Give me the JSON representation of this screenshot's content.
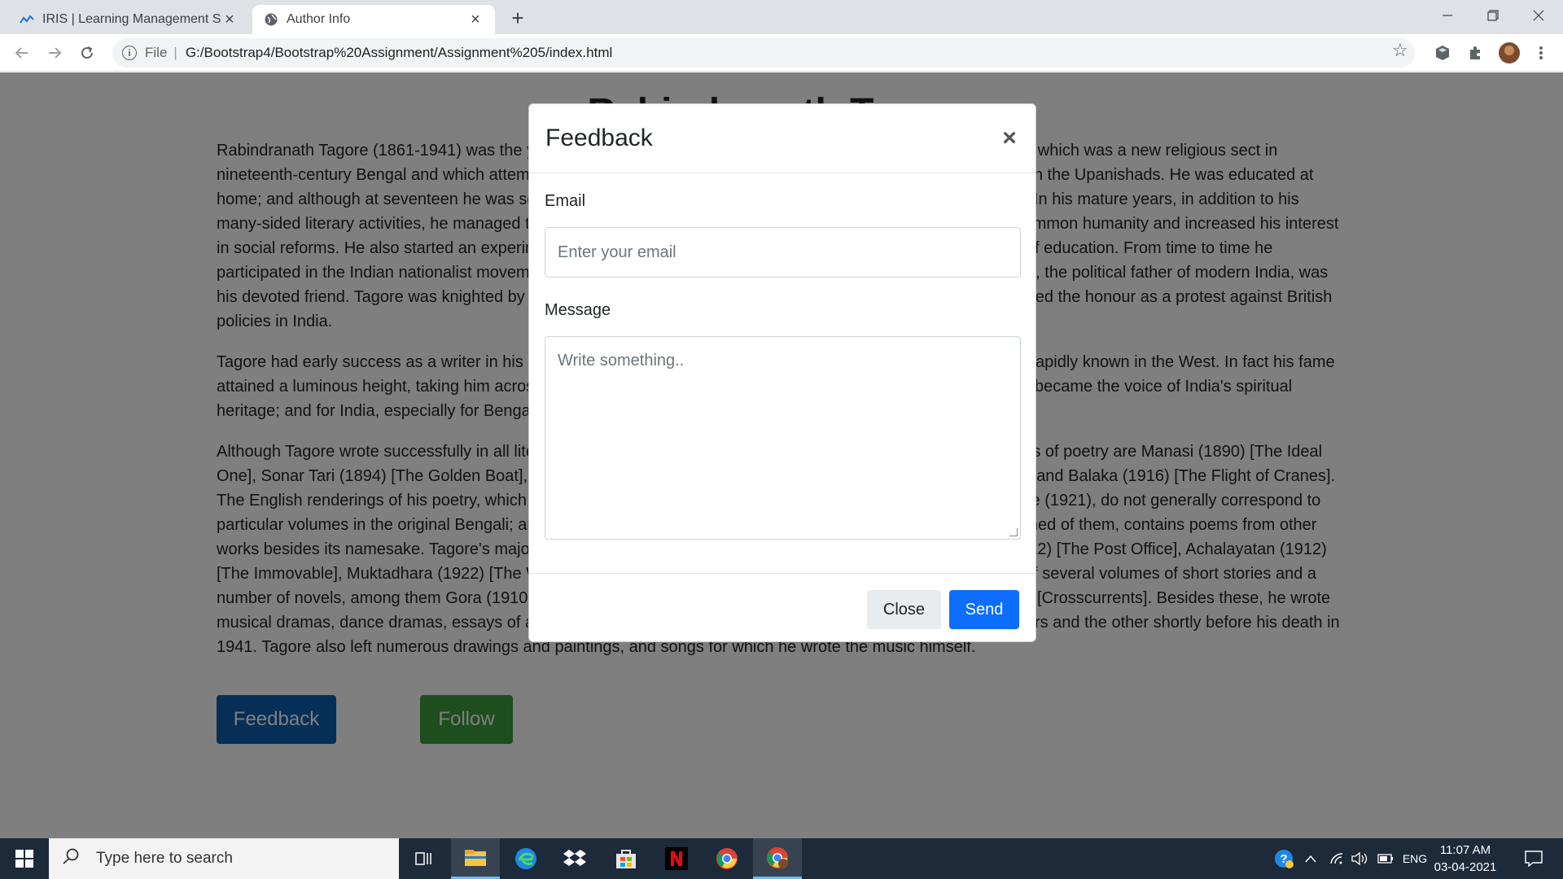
{
  "browser": {
    "tabs": [
      {
        "title": "IRIS | Learning Management Syst",
        "active": false
      },
      {
        "title": "Author Info",
        "active": true
      }
    ],
    "address": {
      "scheme": "File",
      "url": "G:/Bootstrap4/Bootstrap%20Assignment/Assignment%205/index.html"
    }
  },
  "article": {
    "title": "Rabindranath Tagore",
    "paragraphs": [
      "Rabindranath Tagore (1861-1941) was the youngest son of Debendranath Tagore, a leader of the Brahmo Samaj, which was a new religious sect in nineteenth-century Bengal and which attempted a revival of the ultimate monistic basis of Hinduism as laid down in the Upanishads. He was educated at home; and although at seventeen he was sent to England for formal schooling, he did not finish his studies there. In his mature years, in addition to his many-sided literary activities, he managed the family estates, a project which brought him into close touch with common humanity and increased his interest in social reforms. He also started an experimental school at Shantiniketan where he tried his Upanishadic ideals of education. From time to time he participated in the Indian nationalist movement, though in his own non-sentimental and visionary way; and Gandhi, the political father of modern India, was his devoted friend. Tagore was knighted by the ruling British Government in 1915, but within a few years he resigned the honour as a protest against British policies in India.",
      "Tagore had early success as a writer in his native Bengal. With his translations of some of his poems he became rapidly known in the West. In fact his fame attained a luminous height, taking him across continents on lecture tours and tours of friendship. For the world he became the voice of India's spiritual heritage; and for India, especially for Bengal, he became a great living institution.",
      "Although Tagore wrote successfully in all literary genres, he was first of all a poet. Among his fifty and odd volumes of poetry are Manasi (1890) [The Ideal One], Sonar Tari (1894) [The Golden Boat], Gitanjali (1910) [Song Offerings], Gitimalya (1914) [Wreath of Songs], and Balaka (1916) [The Flight of Cranes]. The English renderings of his poetry, which include The Gardener (1913), Fruit-Gathering (1916), and The Fugitive (1921), do not generally correspond to particular volumes in the original Bengali; and in spite of its title, Gitanjali: Song Offerings (1912), the most acclaimed of them, contains poems from other works besides its namesake. Tagore's major plays are Raja (1910) [The King of the Dark Chamber], Dakghar (1912) [The Post Office], Achalayatan (1912) [The Immovable], Muktadhara (1922) [The Waterfall], and Raktakaravi (1926) [Red Oleanders]. He is the author of several volumes of short stories and a number of novels, among them Gora (1910), Ghare-Baire (1916) [The Home and the World], and Yogayog (1929) [Crosscurrents]. Besides these, he wrote musical dramas, dance dramas, essays of all types, travel diaries, and two autobiographies, one in his middle years and the other shortly before his death in 1941. Tagore also left numerous drawings and paintings, and songs for which he wrote the music himself."
    ],
    "buttons": {
      "feedback": "Feedback",
      "follow": "Follow"
    }
  },
  "modal": {
    "title": "Feedback",
    "close_glyph": "×",
    "email_label": "Email",
    "email_placeholder": "Enter your email",
    "message_label": "Message",
    "message_placeholder": "Write something..",
    "close_button": "Close",
    "send_button": "Send"
  },
  "taskbar": {
    "search_placeholder": "Type here to search",
    "language": "ENG",
    "time": "11:07 AM",
    "date": "03-04-2021"
  },
  "colors": {
    "primary": "#0d6efd",
    "feedback_btn": "#0d5eae",
    "follow_btn": "#3c9a3c",
    "taskbar": "#1c2a3a"
  }
}
